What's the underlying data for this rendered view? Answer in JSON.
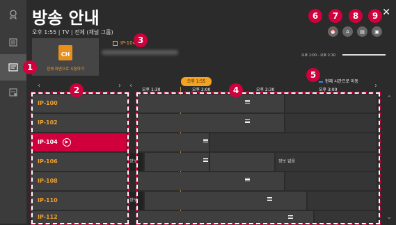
{
  "header": {
    "title": "방송 안내",
    "subtitle": "오후 1:55 | TV | 전체 (채널 그룹)",
    "close": "✕"
  },
  "preview": {
    "ch_icon": "CH",
    "label": "전체 화면으로 시청하기",
    "current_channel": "IP-104"
  },
  "time_range": "오후 1:00 - 오후 2:10",
  "now_button": "현재 시간으로 이동",
  "timeline": {
    "now_label": "오후 1:55",
    "times": [
      "오후 1:30",
      "오후 2:00",
      "오후 2:30",
      "오후 3:00"
    ]
  },
  "toolbar_icons": [
    "reminder-icon",
    "ad-icon",
    "record-icon",
    "view-icon"
  ],
  "channels": [
    {
      "name": "IP-100",
      "active": false
    },
    {
      "name": "IP-102",
      "active": false
    },
    {
      "name": "IP-104",
      "active": true
    },
    {
      "name": "IP-106",
      "active": false
    },
    {
      "name": "IP-108",
      "active": false
    },
    {
      "name": "IP-110",
      "active": false
    },
    {
      "name": "IP-112",
      "active": false
    }
  ],
  "programs": {
    "r3_prefix": "정보",
    "r3_none": "정보 없음",
    "r5_prefix": "정보"
  },
  "badges": [
    "1",
    "2",
    "3",
    "4",
    "5",
    "6",
    "7",
    "8",
    "9"
  ],
  "colors": {
    "accent": "#d0003c",
    "channel_text": "#f0a030",
    "now_bubble": "#f5a21e",
    "now_indicator": "#2b8ef0"
  }
}
